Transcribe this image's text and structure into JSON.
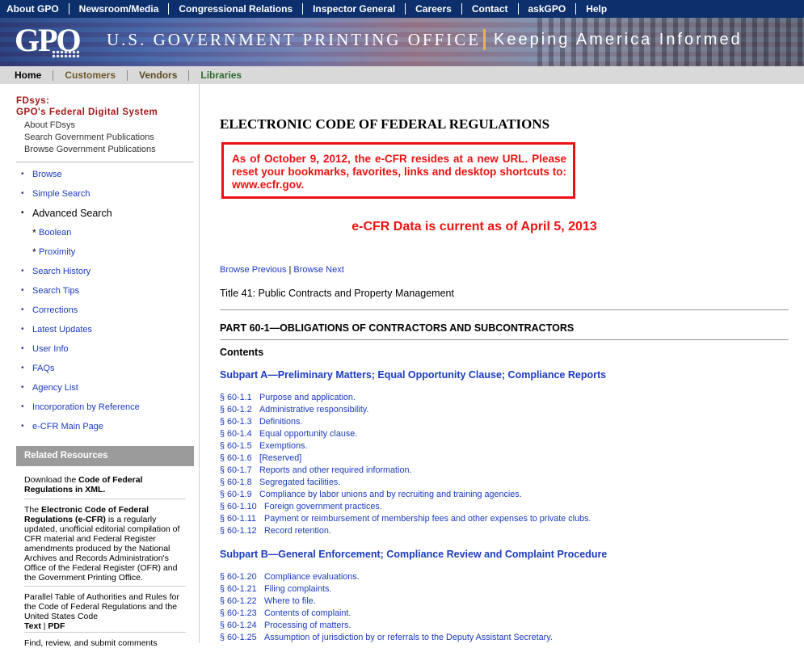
{
  "topnav": [
    "About GPO",
    "Newsroom/Media",
    "Congressional Relations",
    "Inspector General",
    "Careers",
    "Contact",
    "askGPO",
    "Help"
  ],
  "banner": {
    "logo": "GPO",
    "agency": "U.S. GOVERNMENT PRINTING OFFICE",
    "tagline": "Keeping America Informed"
  },
  "subnav": [
    "Home",
    "Customers",
    "Vendors",
    "Libraries"
  ],
  "sidebar": {
    "fdsys_title_1": "FDsys:",
    "fdsys_title_2": "GPO's Federal Digital System",
    "fdsys_links": [
      "About FDsys",
      "Search Government Publications",
      "Browse Government Publications"
    ],
    "nav": [
      {
        "label": "Browse",
        "kind": "link"
      },
      {
        "label": "Simple Search",
        "kind": "link"
      },
      {
        "label": "Advanced Search",
        "kind": "header"
      },
      {
        "label": "Boolean",
        "kind": "sub"
      },
      {
        "label": "Proximity",
        "kind": "sub"
      },
      {
        "label": "Search History",
        "kind": "link"
      },
      {
        "label": "Search Tips",
        "kind": "link"
      },
      {
        "label": "Corrections",
        "kind": "link"
      },
      {
        "label": "Latest Updates",
        "kind": "link"
      },
      {
        "label": "User Info",
        "kind": "link"
      },
      {
        "label": "FAQs",
        "kind": "link"
      },
      {
        "label": "Agency List",
        "kind": "link"
      },
      {
        "label": "Incorporation by Reference",
        "kind": "link"
      },
      {
        "label": "e-CFR Main Page",
        "kind": "link"
      }
    ],
    "related_title": "Related Resources",
    "related": {
      "download_prefix": "Download the ",
      "download_link": "Code of Federal Regulations in XML.",
      "ecfr_prefix": "The ",
      "ecfr_bold": "Electronic Code of Federal Regulations (e-CFR)",
      "ecfr_rest": " is a regularly updated, unofficial editorial compilation of CFR material and Federal Register amendments produced by the National Archives and Records Administration's Office of the Federal Register (OFR) and the Government Printing Office.",
      "parallel_text": "Parallel Table of Authorities and Rules for the Code of Federal Regulations and the United States Code",
      "parallel_text_link": "Text",
      "parallel_sep": " | ",
      "parallel_pdf_link": "PDF",
      "truncated": "Find, review, and submit comments"
    }
  },
  "main": {
    "doc_title": "ELECTRONIC CODE OF FEDERAL REGULATIONS",
    "notice": "As of October 9, 2012, the e-CFR resides at a new URL. Please reset your bookmarks, favorites, links and desktop shortcuts to: www.ecfr.gov.",
    "current": "e-CFR Data is current as of April 5, 2013",
    "browse_prev": "Browse Previous",
    "browse_sep": "|",
    "browse_next": "Browse Next",
    "title": "Title 41: Public Contracts and Property Management",
    "part": "PART 60-1—OBLIGATIONS OF CONTRACTORS AND SUBCONTRACTORS",
    "contents": "Contents",
    "subpart_a": "Subpart A—Preliminary Matters; Equal Opportunity Clause; Compliance Reports",
    "sections_a": [
      {
        "num": "§ 60-1.1",
        "title": "Purpose and application."
      },
      {
        "num": "§ 60-1.2",
        "title": "Administrative responsibility."
      },
      {
        "num": "§ 60-1.3",
        "title": "Definitions."
      },
      {
        "num": "§ 60-1.4",
        "title": "Equal opportunity clause."
      },
      {
        "num": "§ 60-1.5",
        "title": "Exemptions."
      },
      {
        "num": "§ 60-1.6",
        "title": "[Reserved]"
      },
      {
        "num": "§ 60-1.7",
        "title": "Reports and other required information."
      },
      {
        "num": "§ 60-1.8",
        "title": "Segregated facilities."
      },
      {
        "num": "§ 60-1.9",
        "title": "Compliance by labor unions and by recruiting and training agencies."
      },
      {
        "num": "§ 60-1.10",
        "title": "Foreign government practices."
      },
      {
        "num": "§ 60-1.11",
        "title": "Payment or reimbursement of membership fees and other expenses to private clubs."
      },
      {
        "num": "§ 60-1.12",
        "title": "Record retention."
      }
    ],
    "subpart_b": "Subpart B—General Enforcement; Compliance Review and Complaint Procedure",
    "sections_b": [
      {
        "num": "§ 60-1.20",
        "title": "Compliance evaluations."
      },
      {
        "num": "§ 60-1.21",
        "title": "Filing complaints."
      },
      {
        "num": "§ 60-1.22",
        "title": "Where to file."
      },
      {
        "num": "§ 60-1.23",
        "title": "Contents of complaint."
      },
      {
        "num": "§ 60-1.24",
        "title": "Processing of matters."
      },
      {
        "num": "§ 60-1.25",
        "title": "Assumption of jurisdiction by or referrals to the Deputy Assistant Secretary."
      }
    ]
  },
  "colors": {
    "nav_bg": "#0d2f6b",
    "link": "#1a3bbf",
    "alert": "#e11111",
    "fdsys": "#a01818"
  }
}
